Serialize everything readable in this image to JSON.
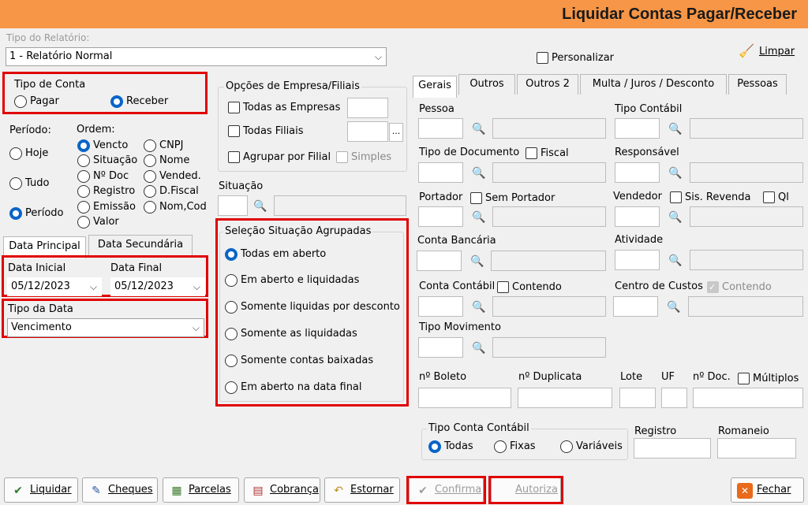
{
  "window": {
    "title": "Liquidar Contas Pagar/Receber"
  },
  "relatorio": {
    "label": "Tipo do Relatório:",
    "value": "1 - Relatório Normal",
    "personalizar": "Personalizar",
    "limpar": "Limpar"
  },
  "tipo_conta": {
    "label": "Tipo de Conta",
    "pagar": "Pagar",
    "receber": "Receber"
  },
  "periodo": {
    "label": "Período:",
    "hoje": "Hoje",
    "tudo": "Tudo",
    "periodo": "Período"
  },
  "ordem": {
    "label": "Ordem:",
    "items": [
      "Vencto",
      "CNPJ",
      "Situação",
      "Nome",
      "Nº Doc",
      "Vended.",
      "Registro",
      "D.Fiscal",
      "Emissão",
      "Nom,Cod",
      "Valor"
    ]
  },
  "data_tabs": {
    "principal": "Data Principal",
    "secundaria": "Data Secundária"
  },
  "datas": {
    "inicial_label": "Data Inicial",
    "inicial": "05/12/2023",
    "final_label": "Data Final",
    "final": "05/12/2023"
  },
  "tipo_data": {
    "label": "Tipo da Data",
    "value": "Vencimento"
  },
  "empresa": {
    "label": "Opções de Empresa/Filiais",
    "todas_empresas": "Todas as Empresas",
    "todas_filiais": "Todas Filiais",
    "agrupar": "Agrupar por Filial",
    "simples": "Simples",
    "ellipsis": "..."
  },
  "situacao": {
    "label": "Situação"
  },
  "selecao": {
    "label": "Seleção Situação Agrupadas",
    "items": [
      "Todas em aberto",
      "Em aberto e liquidadas",
      "Somente liquidas por desconto",
      "Somente as liquidadas",
      "Somente contas baixadas",
      "Em aberto na data final"
    ]
  },
  "tabs": [
    "Gerais",
    "Outros",
    "Outros 2",
    "Multa / Juros / Desconto",
    "Pessoas"
  ],
  "gerais": {
    "pessoa": "Pessoa",
    "tipo_contabil": "Tipo Contábil",
    "tipo_documento": "Tipo de Documento",
    "fiscal": "Fiscal",
    "responsavel": "Responsável",
    "portador": "Portador",
    "sem_portador": "Sem Portador",
    "vendedor": "Vendedor",
    "sis_revenda": "Sis. Revenda",
    "ql": "Ql",
    "conta_bancaria": "Conta Bancária",
    "atividade": "Atividade",
    "conta_contabil": "Conta Contábil",
    "contendo": "Contendo",
    "centro_custos": "Centro de Custos",
    "contendo2": "Contendo",
    "tipo_movimento": "Tipo Movimento",
    "n_boleto": "nº Boleto",
    "n_duplicata": "nº Duplicata",
    "lote": "Lote",
    "uf": "UF",
    "n_doc": "nº Doc.",
    "multiplos": "Múltiplos",
    "tipo_conta_contabil": "Tipo Conta Contábil",
    "todas": "Todas",
    "fixas": "Fixas",
    "variaveis": "Variáveis",
    "registro": "Registro",
    "romaneio": "Romaneio"
  },
  "buttons": {
    "liquidar": "Liquidar",
    "cheques": "Cheques",
    "parcelas": "Parcelas",
    "cobranca": "Cobrança",
    "estornar": "Estornar",
    "confirma": "Confirma",
    "autoriza": "Autoriza",
    "fechar": "Fechar"
  },
  "colors": {
    "titlebar": "#f79646",
    "highlight": "#e00000",
    "radio_on": "#0a64c8"
  }
}
